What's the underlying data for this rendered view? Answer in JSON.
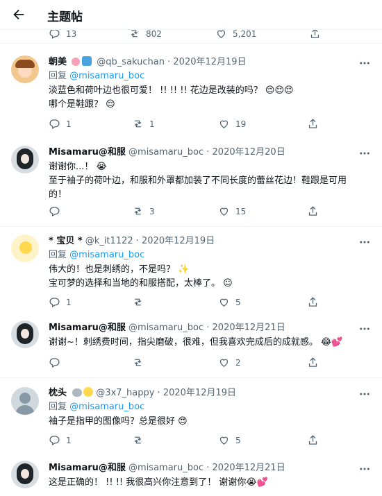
{
  "header": {
    "title": "主题帖"
  },
  "top_stats": {
    "reply_count": "13",
    "retweet_count": "802",
    "like_count": "5,201"
  },
  "threads": [
    {
      "id": "t1",
      "name": "朝美",
      "handle": "@qb_sakuchan",
      "date": "· 2020年12月19日",
      "reply_prefix": "回复",
      "reply_to": "@misamaru_boc",
      "lines": [
        "淡蓝色和荷叶边也很可爱！ !! !! !! 花边是改装的吗？ 😌😌😌",
        "哪个是鞋跟？ 😌"
      ],
      "counts": {
        "reply": "1",
        "retweet": "1",
        "like": "19"
      }
    },
    {
      "id": "t2",
      "name": "Misamaru@和服",
      "handle": "@misamaru_boc",
      "date": "· 2020年12月20日",
      "lines": [
        "谢谢你...！ 😭",
        "至于袖子的荷叶边，和服和外罩都加装了不同长度的蕾丝花边！鞋跟是可用",
        "的！"
      ],
      "counts": {
        "reply": "",
        "retweet": "3",
        "like": "15"
      }
    },
    {
      "id": "t3",
      "name": "* 宝贝 *",
      "handle": "@k_it1122",
      "date": "· 2020年12月19日",
      "reply_prefix": "回复",
      "reply_to": "@misamaru_boc",
      "lines": [
        "伟大的！也是刺绣的，不是吗？ ✨",
        "宝可梦的选择和当地的和服搭配，太棒了。 ☺"
      ],
      "counts": {
        "reply": "1",
        "retweet": "",
        "like": "5"
      }
    },
    {
      "id": "t4",
      "name": "Misamaru@和服",
      "handle": "@misamaru_boc",
      "date": "· 2020年12月21日",
      "lines": [
        "谢谢~！刺绣费时间，指尖磨破，很难，但我喜欢完成后的成就感。 😂💕"
      ],
      "counts": {
        "reply": "",
        "retweet": "",
        "like": "2"
      }
    },
    {
      "id": "t5",
      "name": "枕头",
      "handle": "@3x7_happy",
      "date": "· 2020年12月19日",
      "reply_prefix": "回复",
      "reply_to": "@misamaru_boc",
      "lines": [
        "袖子是指甲的图像吗？总是很好 😍"
      ],
      "counts": {
        "reply": "1",
        "retweet": "",
        "like": "5"
      }
    },
    {
      "id": "t6",
      "name": "Misamaru@和服",
      "handle": "@misamaru_boc",
      "date": "· 2020年12月21日",
      "lines": [
        "这是正确的！ !! !! 我很高兴你注意到了！ 谢谢你😭💕"
      ]
    }
  ]
}
